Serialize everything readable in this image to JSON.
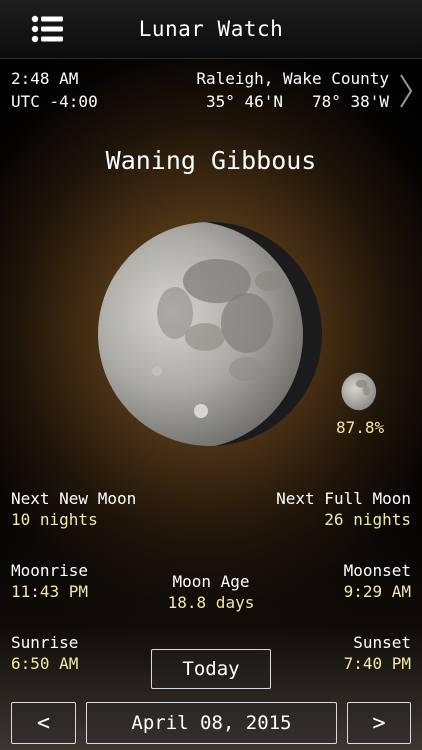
{
  "nav": {
    "title": "Lunar Watch",
    "menu_icon": "list-icon"
  },
  "time": {
    "local": "2:48 AM",
    "utc_offset": "UTC -4:00"
  },
  "location": {
    "name": "Raleigh, Wake County",
    "lat": "35° 46'N",
    "lon": "78° 38'W"
  },
  "phase": {
    "name": "Waning Gibbous",
    "illumination": "87.8%"
  },
  "next_new_moon": {
    "label": "Next New Moon",
    "value": "10 nights"
  },
  "next_full_moon": {
    "label": "Next Full Moon",
    "value": "26 nights"
  },
  "moonrise": {
    "label": "Moonrise",
    "value": "11:43 PM"
  },
  "moon_age": {
    "label": "Moon Age",
    "value": "18.8 days"
  },
  "moonset": {
    "label": "Moonset",
    "value": "9:29 AM"
  },
  "sunrise": {
    "label": "Sunrise",
    "value": "6:50 AM"
  },
  "sunset": {
    "label": "Sunset",
    "value": "7:40 PM"
  },
  "controls": {
    "today": "Today",
    "prev": "<",
    "date": "April 08, 2015",
    "next": ">"
  },
  "colors": {
    "value_text": "#f1e8a8",
    "text": "#ffffff"
  }
}
